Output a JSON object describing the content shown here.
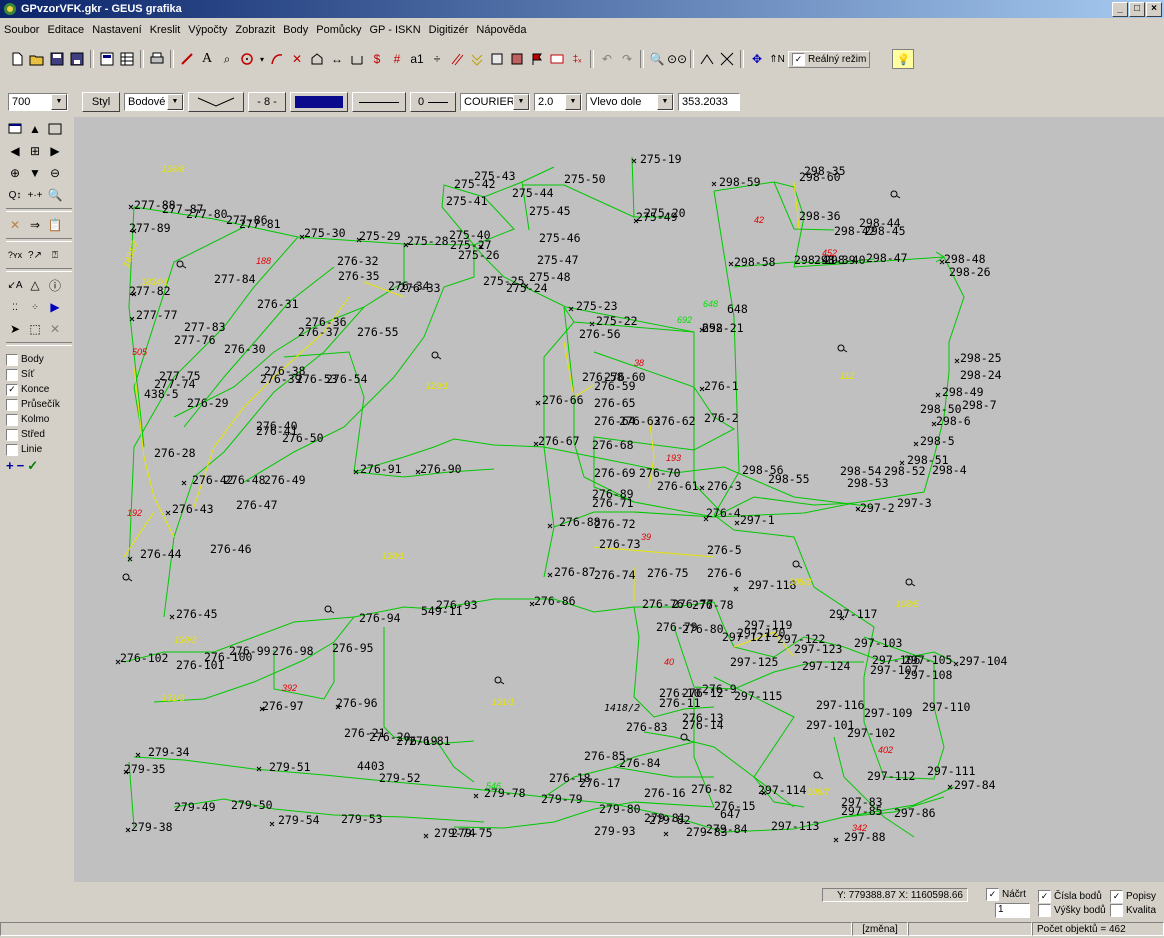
{
  "window": {
    "title": "GPvzorVFK.gkr - GEUS grafika",
    "controls": [
      "_",
      "□",
      "×"
    ]
  },
  "menu": [
    "Soubor",
    "Editace",
    "Nastavení",
    "Kreslit",
    "Výpočty",
    "Zobrazit",
    "Body",
    "Pomůcky",
    "GP - ISKN",
    "Digitizér",
    "Nápověda"
  ],
  "toolbar": {
    "text_tool": "A",
    "a1_tool": "a1",
    "realny_label": "Reálný režim",
    "realny_checked": true
  },
  "props": {
    "layer": "700",
    "style_button": "Styl",
    "point_type": "Bodové",
    "step": "- 8 -",
    "line_width": "0",
    "font": "COURIER",
    "font_size": "2.0",
    "anchor": "Vlevo dole",
    "angle": "353.2033",
    "color": "#0a0a8c"
  },
  "snap": {
    "items": [
      {
        "label": "Body",
        "checked": false
      },
      {
        "label": "Síť",
        "checked": false
      },
      {
        "label": "Konce",
        "checked": true
      },
      {
        "label": "Průsečík",
        "checked": false
      },
      {
        "label": "Kolmo",
        "checked": false
      },
      {
        "label": "Střed",
        "checked": false
      },
      {
        "label": "Linie",
        "checked": false
      }
    ]
  },
  "status": {
    "coords": "Y: 779388.87  X: 1160598.66",
    "nacist_label": "Náčrt",
    "nacist_checked": true,
    "nacist_value": "1",
    "cisla_bodu": "Čísla bodů",
    "popisy": "Popisy",
    "vysky_bodu": "Výšky bodů",
    "kvalita": "Kvalita",
    "zmena": "[změna]",
    "pocet": "Počet objektů = 462"
  },
  "map": {
    "line_color": "#00c800",
    "boundary_color": "#e6e600",
    "parcel_red": "#e00000",
    "parcel_yellow": "#e6e600",
    "point_labels": [
      "277-88",
      "277-87",
      "277-89",
      "277-80",
      "277-86",
      "277-81",
      "277-84",
      "277-82",
      "277-77",
      "277-83",
      "277-76",
      "277-75",
      "277-74",
      "438-5",
      "275-30",
      "275-29",
      "275-28",
      "275-27",
      "275-26",
      "275-40",
      "275-41",
      "275-42",
      "275-43",
      "275-44",
      "275-45",
      "275-46",
      "275-47",
      "275-48",
      "275-25",
      "275-24",
      "275-23",
      "275-22",
      "275-50",
      "275-19",
      "275-49",
      "275-20",
      "276-32",
      "276-35",
      "276-34",
      "276-33",
      "276-31",
      "276-36",
      "276-37",
      "276-55",
      "276-30",
      "276-38",
      "276-39",
      "276-53",
      "276-54",
      "276-29",
      "276-40",
      "276-41",
      "276-50",
      "276-28",
      "276-42",
      "276-48",
      "276-49",
      "276-43",
      "276-47",
      "276-44",
      "276-46",
      "276-45",
      "276-91",
      "276-90",
      "276-56",
      "276-58",
      "276-60",
      "276-59",
      "276-66",
      "276-65",
      "276-64",
      "276-63",
      "276-62",
      "276-1",
      "276-2",
      "276-67",
      "276-68",
      "276-69",
      "276-70",
      "276-61",
      "276-3",
      "276-89",
      "276-71",
      "276-4",
      "276-88",
      "276-72",
      "276-73",
      "276-5",
      "276-87",
      "276-74",
      "276-75",
      "276-6",
      "276-86",
      "276-76",
      "276-77",
      "276-78",
      "276-79",
      "276-80",
      "276-9",
      "276-10",
      "276-11",
      "276-12",
      "276-13",
      "276-14",
      "276-83",
      "276-85",
      "276-84",
      "276-18",
      "276-17",
      "276-16",
      "276-15",
      "276-82",
      "276-93",
      "276-94",
      "276-95",
      "276-96",
      "276-97",
      "276-98",
      "276-99",
      "276-100",
      "276-101",
      "276-102",
      "276-21",
      "276-20",
      "276-19",
      "276-81",
      "298-59",
      "298-60",
      "298-35",
      "298-36",
      "298-44",
      "298-45",
      "298-42",
      "298-40",
      "298-47",
      "298-48",
      "298-26",
      "298-58",
      "298-41",
      "298-39",
      "298-21",
      "298-25",
      "298-24",
      "298-49",
      "298-7",
      "298-50",
      "298-6",
      "298-5",
      "298-51",
      "298-4",
      "298-52",
      "298-54",
      "298-53",
      "298-55",
      "298-56",
      "648",
      "652",
      "297-1",
      "297-2",
      "297-3",
      "297-118",
      "297-117",
      "297-119",
      "297-120",
      "297-121",
      "297-122",
      "297-123",
      "297-124",
      "297-125",
      "297-103",
      "297-105",
      "297-104",
      "297-106",
      "297-107",
      "297-108",
      "297-115",
      "297-116",
      "297-109",
      "297-110",
      "297-101",
      "297-102",
      "297-112",
      "297-111",
      "297-84",
      "297-114",
      "297-113",
      "297-83",
      "297-85",
      "297-86",
      "297-88",
      "647",
      "279-34",
      "279-35",
      "279-51",
      "279-52",
      "4403",
      "279-78",
      "279-79",
      "279-80",
      "279-81",
      "279-82",
      "279-83",
      "279-84",
      "279-93",
      "279-49",
      "279-50",
      "279-38",
      "279-54",
      "279-53",
      "279-74",
      "279-75",
      "549-11",
      "1418/2"
    ],
    "parcel_labels": [
      "136/8",
      "1834/2",
      "1834/1",
      "505",
      "129/1",
      "188",
      "192",
      "130/1",
      "130/3",
      "131/3",
      "392",
      "131/1",
      "38",
      "193",
      "39",
      "40",
      "42",
      "452",
      "112",
      "108/2",
      "108/5",
      "402",
      "108/7",
      "342",
      "648",
      "692",
      "546"
    ]
  }
}
